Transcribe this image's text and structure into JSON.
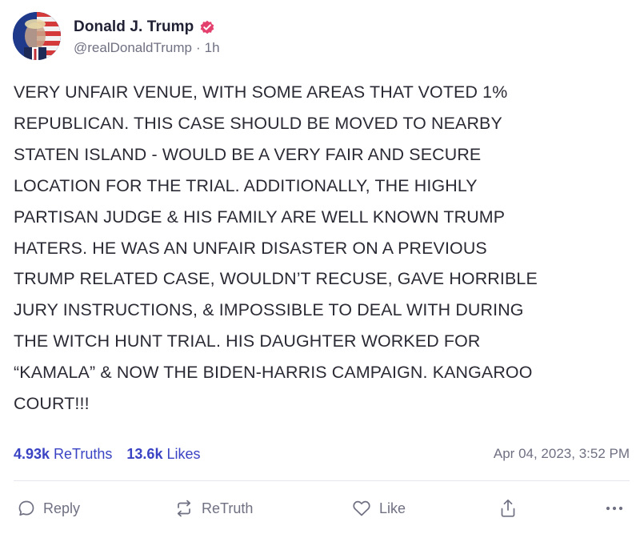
{
  "author": {
    "display_name": "Donald J. Trump",
    "handle": "@realDonaldTrump",
    "separator": "·",
    "age": "1h",
    "verified_icon": "verified-badge-icon",
    "verified_color": "#e3406e"
  },
  "post": {
    "text": "VERY UNFAIR VENUE, WITH SOME AREAS THAT VOTED 1%\nREPUBLICAN. THIS CASE SHOULD BE MOVED TO NEARBY\nSTATEN ISLAND - WOULD BE A VERY FAIR AND SECURE\nLOCATION FOR THE TRIAL. ADDITIONALLY, THE HIGHLY\nPARTISAN JUDGE & HIS FAMILY ARE WELL KNOWN TRUMP\nHATERS. HE WAS AN UNFAIR DISASTER ON A PREVIOUS\nTRUMP RELATED CASE, WOULDN’T RECUSE, GAVE HORRIBLE\nJURY INSTRUCTIONS, & IMPOSSIBLE TO DEAL WITH DURING\nTHE WITCH HUNT TRIAL. HIS DAUGHTER WORKED FOR\n“KAMALA” & NOW THE BIDEN-HARRIS CAMPAIGN. KANGAROO\nCOURT!!!"
  },
  "stats": {
    "retruths_count": "4.93k",
    "retruths_label": "ReTruths",
    "likes_count": "13.6k",
    "likes_label": "Likes",
    "timestamp": "Apr 04, 2023, 3:52 PM",
    "accent_color": "#3a43c4"
  },
  "actions": {
    "reply_label": "Reply",
    "retruth_label": "ReTruth",
    "like_label": "Like",
    "icons": [
      "reply-icon",
      "retruth-icon",
      "like-icon",
      "share-icon",
      "more-icon"
    ]
  }
}
